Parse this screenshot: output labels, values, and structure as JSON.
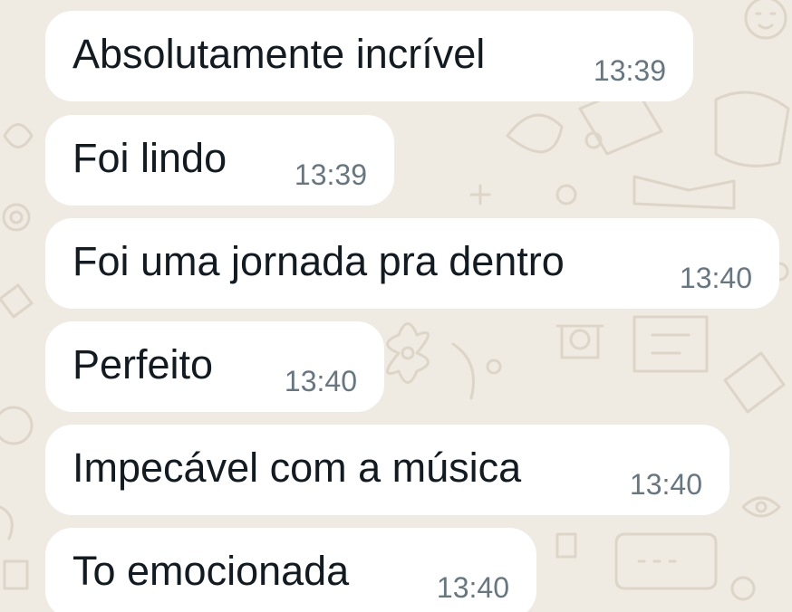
{
  "chat": {
    "wallpaper_color": "#efeae2",
    "bubble_color": "#ffffff",
    "messages": [
      {
        "text": "Absolutamente incrível",
        "time": "13:39"
      },
      {
        "text": "Foi lindo",
        "time": "13:39"
      },
      {
        "text": "Foi uma jornada pra dentro",
        "time": "13:40"
      },
      {
        "text": "Perfeito",
        "time": "13:40"
      },
      {
        "text": "Impecável com a música",
        "time": "13:40"
      },
      {
        "text": "To emocionada",
        "time": "13:40"
      }
    ]
  }
}
